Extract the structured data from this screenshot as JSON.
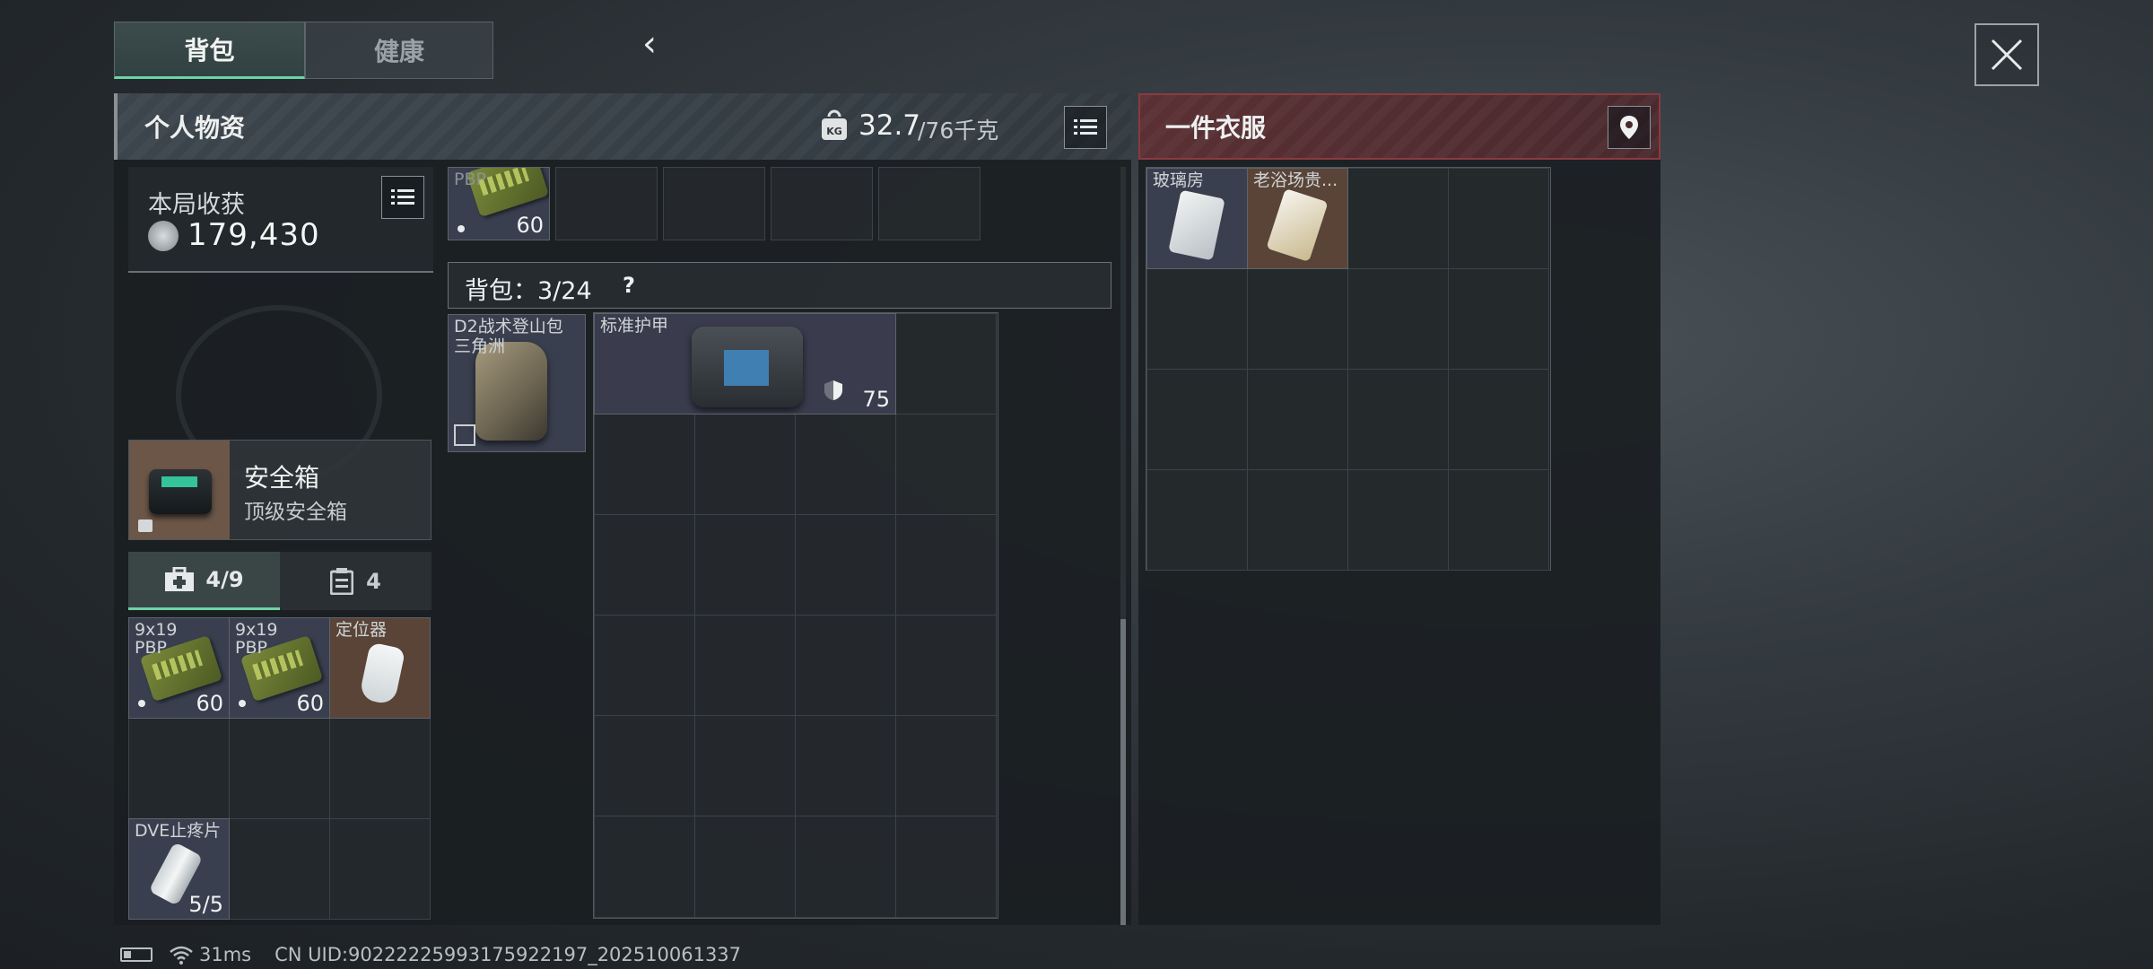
{
  "tabs": {
    "backpack": "背包",
    "health": "健康"
  },
  "personal": {
    "title": "个人物资",
    "weight_current": "32.7",
    "weight_max": "/76千克",
    "weight_icon": "kg-weight-icon"
  },
  "loot": {
    "label": "本局收获",
    "value": "179,430"
  },
  "safebox": {
    "name": "安全箱",
    "subtitle": "顶级安全箱"
  },
  "pouch_tabs": {
    "items_count": "4/9",
    "cards_count": "4"
  },
  "pouch_items": [
    {
      "name": "9x19",
      "name2": "PBP",
      "count": "60"
    },
    {
      "name": "9x19",
      "name2": "PBP",
      "count": "60"
    },
    {
      "name": "定位器",
      "count": ""
    },
    {
      "name": "DVE止疼片",
      "count": "5/5"
    }
  ],
  "top_row_item": {
    "name": "PBP",
    "count": "60"
  },
  "backpack": {
    "label": "背包：3/24",
    "help": "?",
    "bag_name": "D2战术登山包",
    "bag_sub": "三角洲",
    "armor_name": "标准护甲",
    "armor_value": "75"
  },
  "clothing": {
    "title": "一件衣服",
    "items": [
      {
        "name": "玻璃房"
      },
      {
        "name": "老浴场贵..."
      }
    ]
  },
  "footer": {
    "ping": "31ms",
    "uid": "CN UID:902222259931759221​97_202510061337"
  },
  "colors": {
    "accent": "#6fd3a4",
    "clothing_header": "#5a3034"
  }
}
